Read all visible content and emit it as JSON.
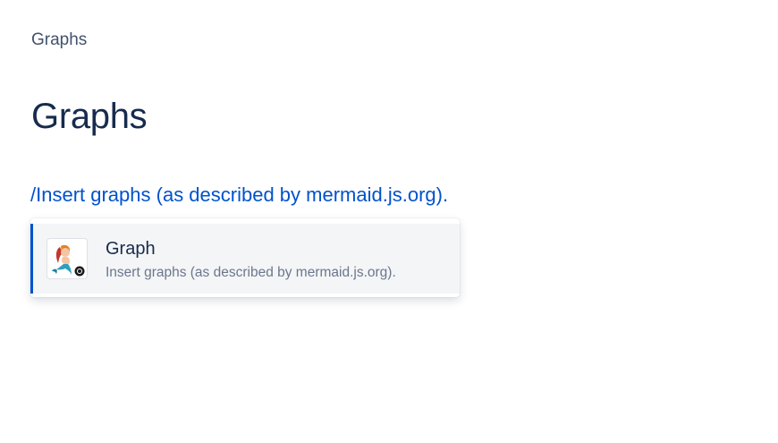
{
  "breadcrumb": {
    "label": "Graphs"
  },
  "page": {
    "title": "Graphs"
  },
  "editor": {
    "typed_text": "/Insert graphs (as described by mermaid.js.org)."
  },
  "quick_insert_menu": {
    "items": [
      {
        "title": "Graph",
        "description": "Insert graphs (as described by mermaid.js.org).",
        "icon": "mermaid-icon"
      }
    ]
  },
  "colors": {
    "link": "#0052cc",
    "title": "#172b4d",
    "muted": "#6b778c",
    "selected_bg": "#f4f5f7"
  }
}
